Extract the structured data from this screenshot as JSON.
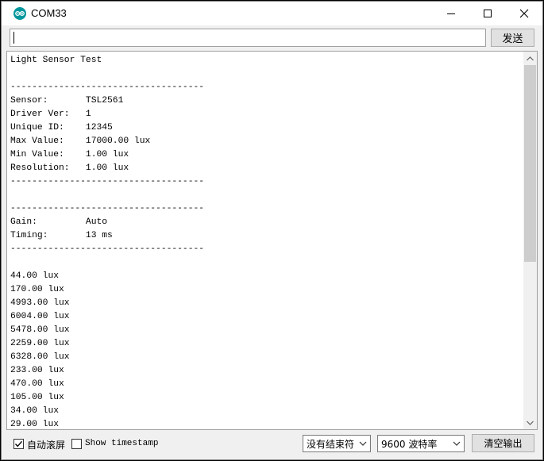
{
  "window": {
    "title": "COM33",
    "icon": "arduino-icon"
  },
  "send": {
    "input_value": "",
    "button_label": "发送"
  },
  "output": {
    "lines": [
      "Light Sensor Test",
      "",
      "------------------------------------",
      "Sensor:       TSL2561",
      "Driver Ver:   1",
      "Unique ID:    12345",
      "Max Value:    17000.00 lux",
      "Min Value:    1.00 lux",
      "Resolution:   1.00 lux",
      "------------------------------------",
      "",
      "------------------------------------",
      "Gain:         Auto",
      "Timing:       13 ms",
      "------------------------------------",
      "",
      "44.00 lux",
      "170.00 lux",
      "4993.00 lux",
      "6004.00 lux",
      "5478.00 lux",
      "2259.00 lux",
      "6328.00 lux",
      "233.00 lux",
      "470.00 lux",
      "105.00 lux",
      "34.00 lux",
      "29.00 lux"
    ]
  },
  "bottom": {
    "autoscroll_label": "自动滚屏",
    "autoscroll_checked": true,
    "timestamp_label": "Show timestamp",
    "timestamp_checked": false,
    "line_ending": "没有结束符",
    "baud_rate": "9600 波特率",
    "clear_label": "清空输出"
  },
  "colors": {
    "arduino_teal": "#00979c",
    "window_bg": "#f0f0f0",
    "scroll_thumb": "#cdcdcd"
  }
}
